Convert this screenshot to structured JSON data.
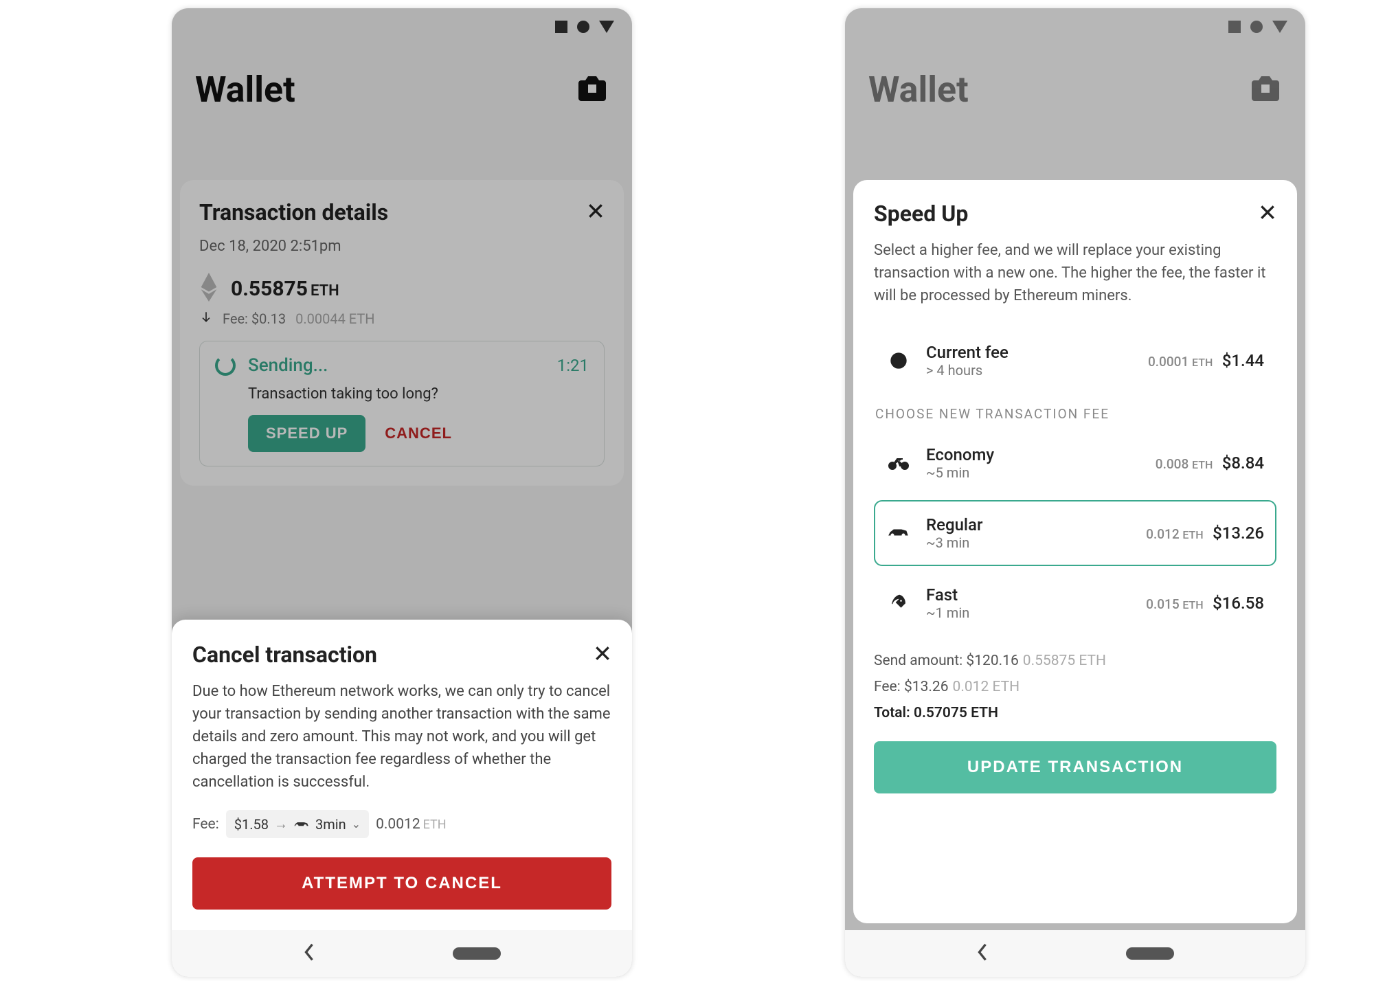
{
  "app_title": "Wallet",
  "left": {
    "tx": {
      "title": "Transaction details",
      "timestamp": "Dec 18, 2020 2:51pm",
      "amount_value": "0.55875",
      "amount_sym": "ETH",
      "fee_usd": "Fee: $0.13",
      "fee_eth": "0.00044 ETH",
      "sending_label": "Sending...",
      "sending_time": "1:21",
      "sending_q": "Transaction taking too long?",
      "speedup_btn": "SPEED UP",
      "cancel_btn": "CANCEL"
    },
    "cancel_sheet": {
      "title": "Cancel transaction",
      "desc": "Due to how Ethereum network works, we can only try to cancel your transaction by sending another transaction with the same details and zero amount. This may not work, and you will get charged the transaction fee regardless of whether the cancellation is successful.",
      "fee_label": "Fee:",
      "chip_usd": "$1.58",
      "chip_time": "3min",
      "fee_eth": "0.0012",
      "fee_eth_sym": "ETH",
      "action": "ATTEMPT TO CANCEL"
    }
  },
  "right": {
    "title": "Speed Up",
    "desc": "Select a higher fee, and we will replace your existing transaction with a new one. The higher the fee, the faster it will be processed by Ethereum miners.",
    "current": {
      "name": "Current fee",
      "time": "> 4 hours",
      "eth": "0.0001",
      "eth_sym": "ETH",
      "usd": "$1.44"
    },
    "section_label": "CHOOSE NEW TRANSACTION FEE",
    "options": [
      {
        "name": "Economy",
        "time": "~5 min",
        "eth": "0.008",
        "usd": "$8.84"
      },
      {
        "name": "Regular",
        "time": "~3 min",
        "eth": "0.012",
        "usd": "$13.26"
      },
      {
        "name": "Fast",
        "time": "~1 min",
        "eth": "0.015",
        "usd": "$16.58"
      }
    ],
    "eth_sym": "ETH",
    "totals": {
      "send_label": "Send amount:",
      "send_usd": "$120.16",
      "send_eth": "0.55875 ETH",
      "fee_label": "Fee:",
      "fee_usd": "$13.26",
      "fee_eth": "0.012 ETH",
      "total_label": "Total:",
      "total_eth": "0.57075 ETH"
    },
    "action": "UPDATE TRANSACTION"
  }
}
